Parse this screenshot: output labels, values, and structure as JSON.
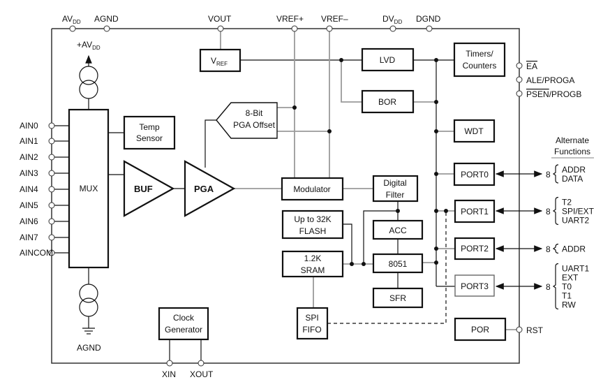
{
  "top_pins": {
    "avdd": {
      "main": "AV",
      "sub": "DD"
    },
    "agnd": "AGND",
    "vout": "VOUT",
    "vref_plus": "VREF+",
    "vref_minus": "VREF–",
    "dvdd": {
      "main": "DV",
      "sub": "DD"
    },
    "dgnd": "DGND"
  },
  "analog_inputs": [
    "AIN0",
    "AIN1",
    "AIN2",
    "AIN3",
    "AIN4",
    "AIN5",
    "AIN6",
    "AIN7",
    "AINCOM"
  ],
  "current_source": {
    "supply": {
      "main": "+AV",
      "sub": "DD"
    },
    "ground": "AGND"
  },
  "blocks": {
    "mux": "MUX",
    "temp_sensor": [
      "Temp",
      "Sensor"
    ],
    "buf": "BUF",
    "pga": "PGA",
    "pga_offset": [
      "8-Bit",
      "PGA Offset"
    ],
    "vref": {
      "main": "V",
      "sub": "REF"
    },
    "lvd": "LVD",
    "bor": "BOR",
    "timers": [
      "Timers/",
      "Counters"
    ],
    "wdt": "WDT",
    "modulator": "Modulator",
    "digital_filter": [
      "Digital",
      "Filter"
    ],
    "flash": [
      "Up to 32K",
      "FLASH"
    ],
    "acc": "ACC",
    "sram": [
      "1.2K",
      "SRAM"
    ],
    "cpu": "8051",
    "sfr": "SFR",
    "spi_fifo": [
      "SPI",
      "FIFO"
    ],
    "clock": [
      "Clock",
      "Generator"
    ],
    "port0": "PORT0",
    "port1": "PORT1",
    "port2": "PORT2",
    "port3": "PORT3",
    "por": "POR"
  },
  "right_pins": {
    "ea": "EA",
    "ale": "ALE/PROGA",
    "psen": "PSEN",
    "progb": "/PROGB",
    "rst": "RST"
  },
  "bottom_pins": {
    "xin": "XIN",
    "xout": "XOUT"
  },
  "alternate_functions": {
    "heading": [
      "Alternate",
      "Functions"
    ],
    "bus_width": "8",
    "port0": [
      "ADDR",
      "DATA"
    ],
    "port1": [
      "T2",
      "SPI/EXT",
      "UART2"
    ],
    "port2": [
      "ADDR"
    ],
    "port3": [
      "UART1",
      "EXT",
      "T0",
      "T1",
      "RW"
    ]
  }
}
